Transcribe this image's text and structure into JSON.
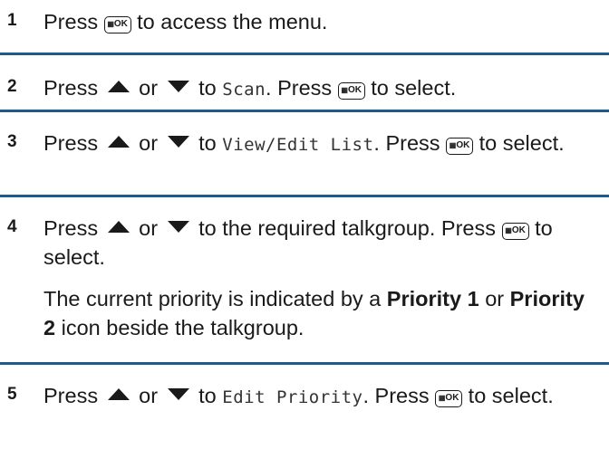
{
  "steps": [
    {
      "number": "1",
      "press": "Press",
      "after_button": "to access the menu."
    },
    {
      "number": "2",
      "press": "Press",
      "or": "or",
      "to": "to",
      "mono": "Scan",
      "press2": ". Press",
      "after_button": "to select."
    },
    {
      "number": "3",
      "press": "Press",
      "or": "or",
      "to": "to",
      "mono": "View/Edit List",
      "press2": ". Press",
      "after_button": "to select."
    },
    {
      "number": "4",
      "press": "Press",
      "or": "or",
      "after_arrows": "to the required talkgroup. Press",
      "after_button": "to select.",
      "note_prefix": "The current priority is indicated by a",
      "bold1": "Priority 1",
      "note_or": "or",
      "bold2": "Priority 2",
      "note_suffix": "icon beside the talkgroup."
    },
    {
      "number": "5",
      "press": "Press",
      "or": "or",
      "to": "to",
      "mono": "Edit Priority",
      "press2": ". Press",
      "after_button": "to select."
    }
  ],
  "ok_button_label": "OK",
  "icons": {
    "menu_ok": "menu-ok-button-icon",
    "up": "up-arrow-icon",
    "down": "down-arrow-icon"
  },
  "colors": {
    "divider": "#1f5a8c",
    "text": "#1a1a1a"
  }
}
